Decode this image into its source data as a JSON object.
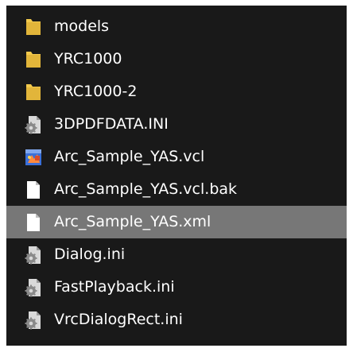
{
  "file_list": {
    "items": [
      {
        "label": "models",
        "icon": "folder-icon",
        "selected": false
      },
      {
        "label": "YRC1000",
        "icon": "folder-icon",
        "selected": false
      },
      {
        "label": "YRC1000-2",
        "icon": "folder-icon",
        "selected": false
      },
      {
        "label": "3DPDFDATA.INI",
        "icon": "settings-file-icon",
        "selected": false
      },
      {
        "label": "Arc_Sample_YAS.vcl",
        "icon": "vcl-file-icon",
        "selected": false
      },
      {
        "label": "Arc_Sample_YAS.vcl.bak",
        "icon": "blank-file-icon",
        "selected": false
      },
      {
        "label": "Arc_Sample_YAS.xml",
        "icon": "blank-file-icon",
        "selected": true
      },
      {
        "label": "Dialog.ini",
        "icon": "settings-file-icon",
        "selected": false
      },
      {
        "label": "FastPlayback.ini",
        "icon": "settings-file-icon",
        "selected": false
      },
      {
        "label": "VrcDialogRect.ini",
        "icon": "settings-file-icon",
        "selected": false
      }
    ]
  },
  "colors": {
    "background": "#191919",
    "selected_row": "#777777",
    "text": "#ffffff",
    "folder": "#f2c94c"
  }
}
